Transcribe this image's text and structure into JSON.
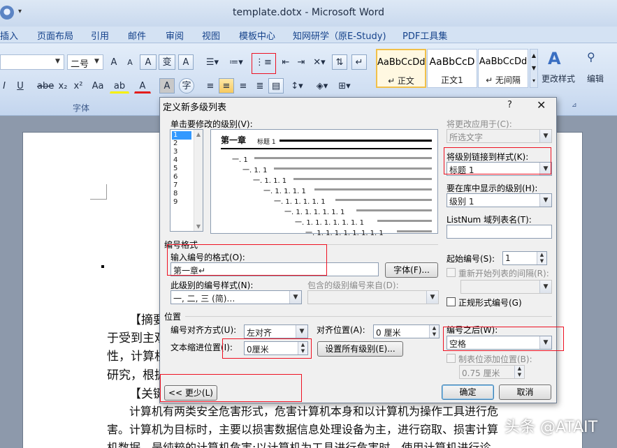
{
  "window": {
    "title": "template.dotx - Microsoft Word"
  },
  "menu": {
    "tabs": [
      "插入",
      "页面布局",
      "引用",
      "邮件",
      "审阅",
      "视图",
      "模板中心",
      "知网研学（原E-Study)",
      "PDF工具集"
    ]
  },
  "ribbon": {
    "font_name": "",
    "font_size": "二号",
    "font_group_label": "字体",
    "styles": [
      {
        "sample": "AaBbCcDd",
        "name": "↵ 正文"
      },
      {
        "sample": "AaBbCcD",
        "name": "正文1"
      },
      {
        "sample": "AaBbCcDd",
        "name": "↵ 无间隔"
      }
    ],
    "change_styles_label": "更改样式",
    "edit_label": "编辑",
    "btn_grow": "A",
    "btn_shrink": "A",
    "btn_clear": "A",
    "btn_phonetic": "变",
    "btn_border": "A",
    "btn_italic": "I",
    "btn_underline": "U",
    "btn_strike": "abe",
    "btn_sub": "x₂",
    "btn_sup": "x²",
    "btn_case": "Aa",
    "btn_highlight": "ab",
    "btn_color": "A",
    "btn_shade": "A",
    "btn_enclose": "字"
  },
  "document": {
    "lines": [
      "【摘要",
      "于受到主观",
      "性，计算机",
      "研究，根据",
      "【关键",
      "计算机有两类安全危害形式，危害计算机本身和以计算机为操作工具进行危",
      "害。计算机为目标时，主要以损害数据信息处理设备为主，进行窃取、损害计算",
      "机数据。是纯粹的计算机危害;以计算机为工具进行危害时，使用计算机进行诊"
    ]
  },
  "dialog": {
    "title": "定义新多级列表",
    "help": "?",
    "close": "✕",
    "click_level_label": "单击要修改的级别(V):",
    "levels": [
      "1",
      "2",
      "3",
      "4",
      "5",
      "6",
      "7",
      "8",
      "9"
    ],
    "selected_level": "1",
    "preview": {
      "heading": "第一章",
      "heading_style": "标题 1",
      "rows": [
        "一. 1",
        "一. 1. 1",
        "一. 1. 1. 1",
        "一. 1. 1. 1. 1",
        "一. 1. 1. 1. 1. 1",
        "一. 1. 1. 1. 1. 1. 1",
        "一. 1. 1. 1. 1. 1. 1. 1",
        "一. 1. 1. 1. 1. 1. 1. 1. 1"
      ]
    },
    "apply_to_label": "将更改应用于(C):",
    "apply_to_value": "所选文字",
    "link_style_label": "将级别链接到样式(K):",
    "link_style_value": "标题 1",
    "gallery_level_label": "要在库中显示的级别(H):",
    "gallery_level_value": "级别 1",
    "listnum_label": "ListNum 域列表名(T):",
    "listnum_value": "",
    "number_format_section": "编号格式",
    "enter_format_label": "输入编号的格式(O):",
    "enter_format_value": "第一章↵",
    "font_button": "字体(F)...",
    "start_at_label": "起始编号(S):",
    "start_at_value": "1",
    "restart_label": "重新开始列表的间隔(R):",
    "restart_value": "",
    "number_style_label": "此级别的编号样式(N):",
    "number_style_value": "一, 二, 三 (简)…",
    "include_level_label": "包含的级别编号来自(D):",
    "include_level_value": "",
    "legal_label": "正规形式编号(G)",
    "position_section": "位置",
    "align_label": "编号对齐方式(U):",
    "align_value": "左对齐",
    "aligned_at_label": "对齐位置(A):",
    "aligned_at_value": "0 厘米",
    "follow_label": "编号之后(W):",
    "follow_value": "空格",
    "indent_label": "文本缩进位置(I):",
    "indent_value": "0厘米",
    "set_all_button": "设置所有级别(E)...",
    "tab_stop_label": "制表位添加位置(B):",
    "tab_stop_value": "0.75 厘米",
    "less_button": "<< 更少(L)",
    "ok_button": "确定",
    "cancel_button": "取消"
  },
  "watermark": "头条 @ATAIT"
}
